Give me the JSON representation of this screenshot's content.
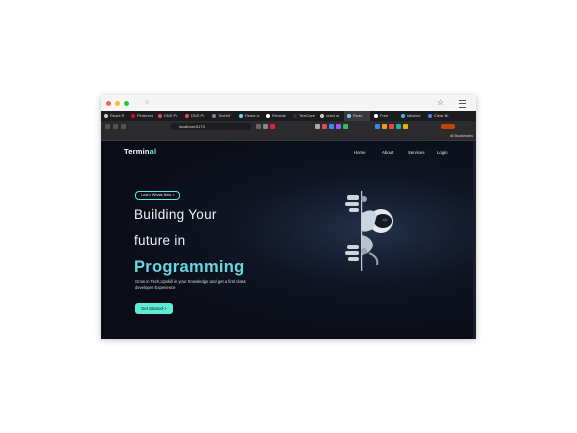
{
  "browser": {
    "tabs": [
      {
        "label": "React R",
        "color": "#cccccc"
      },
      {
        "label": "Pinterest",
        "color": "#e60023"
      },
      {
        "label": "DNS Pr",
        "color": "#e34c4c"
      },
      {
        "label": "DNS Pr",
        "color": "#e34c4c"
      },
      {
        "label": "TechKf",
        "color": "#888888"
      },
      {
        "label": "React Ic",
        "color": "#61dafb"
      },
      {
        "label": "Revealt",
        "color": "#ffffff"
      },
      {
        "label": "TextCare",
        "color": "#333333"
      },
      {
        "label": "react ut",
        "color": "#cccccc"
      },
      {
        "label": "Reac",
        "color": "#61dafb"
      },
      {
        "label": "Free",
        "color": "#ffffff"
      },
      {
        "label": "tailwind",
        "color": "#38bdf8"
      },
      {
        "label": "Clear Br",
        "color": "#4285f4"
      }
    ],
    "url": "localhost:5173",
    "bookmarks": [
      {
        "label": "React Native Paper",
        "color": "#6366f1"
      },
      {
        "label": "ChatGPT",
        "color": "#10a37f"
      },
      {
        "label": "Remix",
        "color": "#ffffff"
      },
      {
        "label": "localserver",
        "color": "#f59e0b"
      },
      {
        "label": "codesandbox",
        "color": "#e5e5e5"
      },
      {
        "label": "codepen",
        "color": "#e5e5e5"
      },
      {
        "label": "Spotify",
        "color": "#1db954"
      },
      {
        "label": "Djangorun",
        "color": "#aaaaaa"
      }
    ],
    "all_bookmarks": "All Bookmarks"
  },
  "site": {
    "logo_main": "Termin",
    "logo_accent": "al",
    "nav": [
      "Home",
      "About",
      "Services",
      "Login"
    ],
    "pill": "Learn Whats New  >",
    "hero_line1": "Building Your",
    "hero_line2": "future in",
    "hero_line3": "Programming",
    "description": "Grow in Tech,Upskill in your Knowledge and get a first class developer Experience",
    "cta": "Get Started  >"
  },
  "colors": {
    "accent": "#5eead4",
    "heading_accent": "#67d7e0",
    "background": "#0b0f1a"
  }
}
